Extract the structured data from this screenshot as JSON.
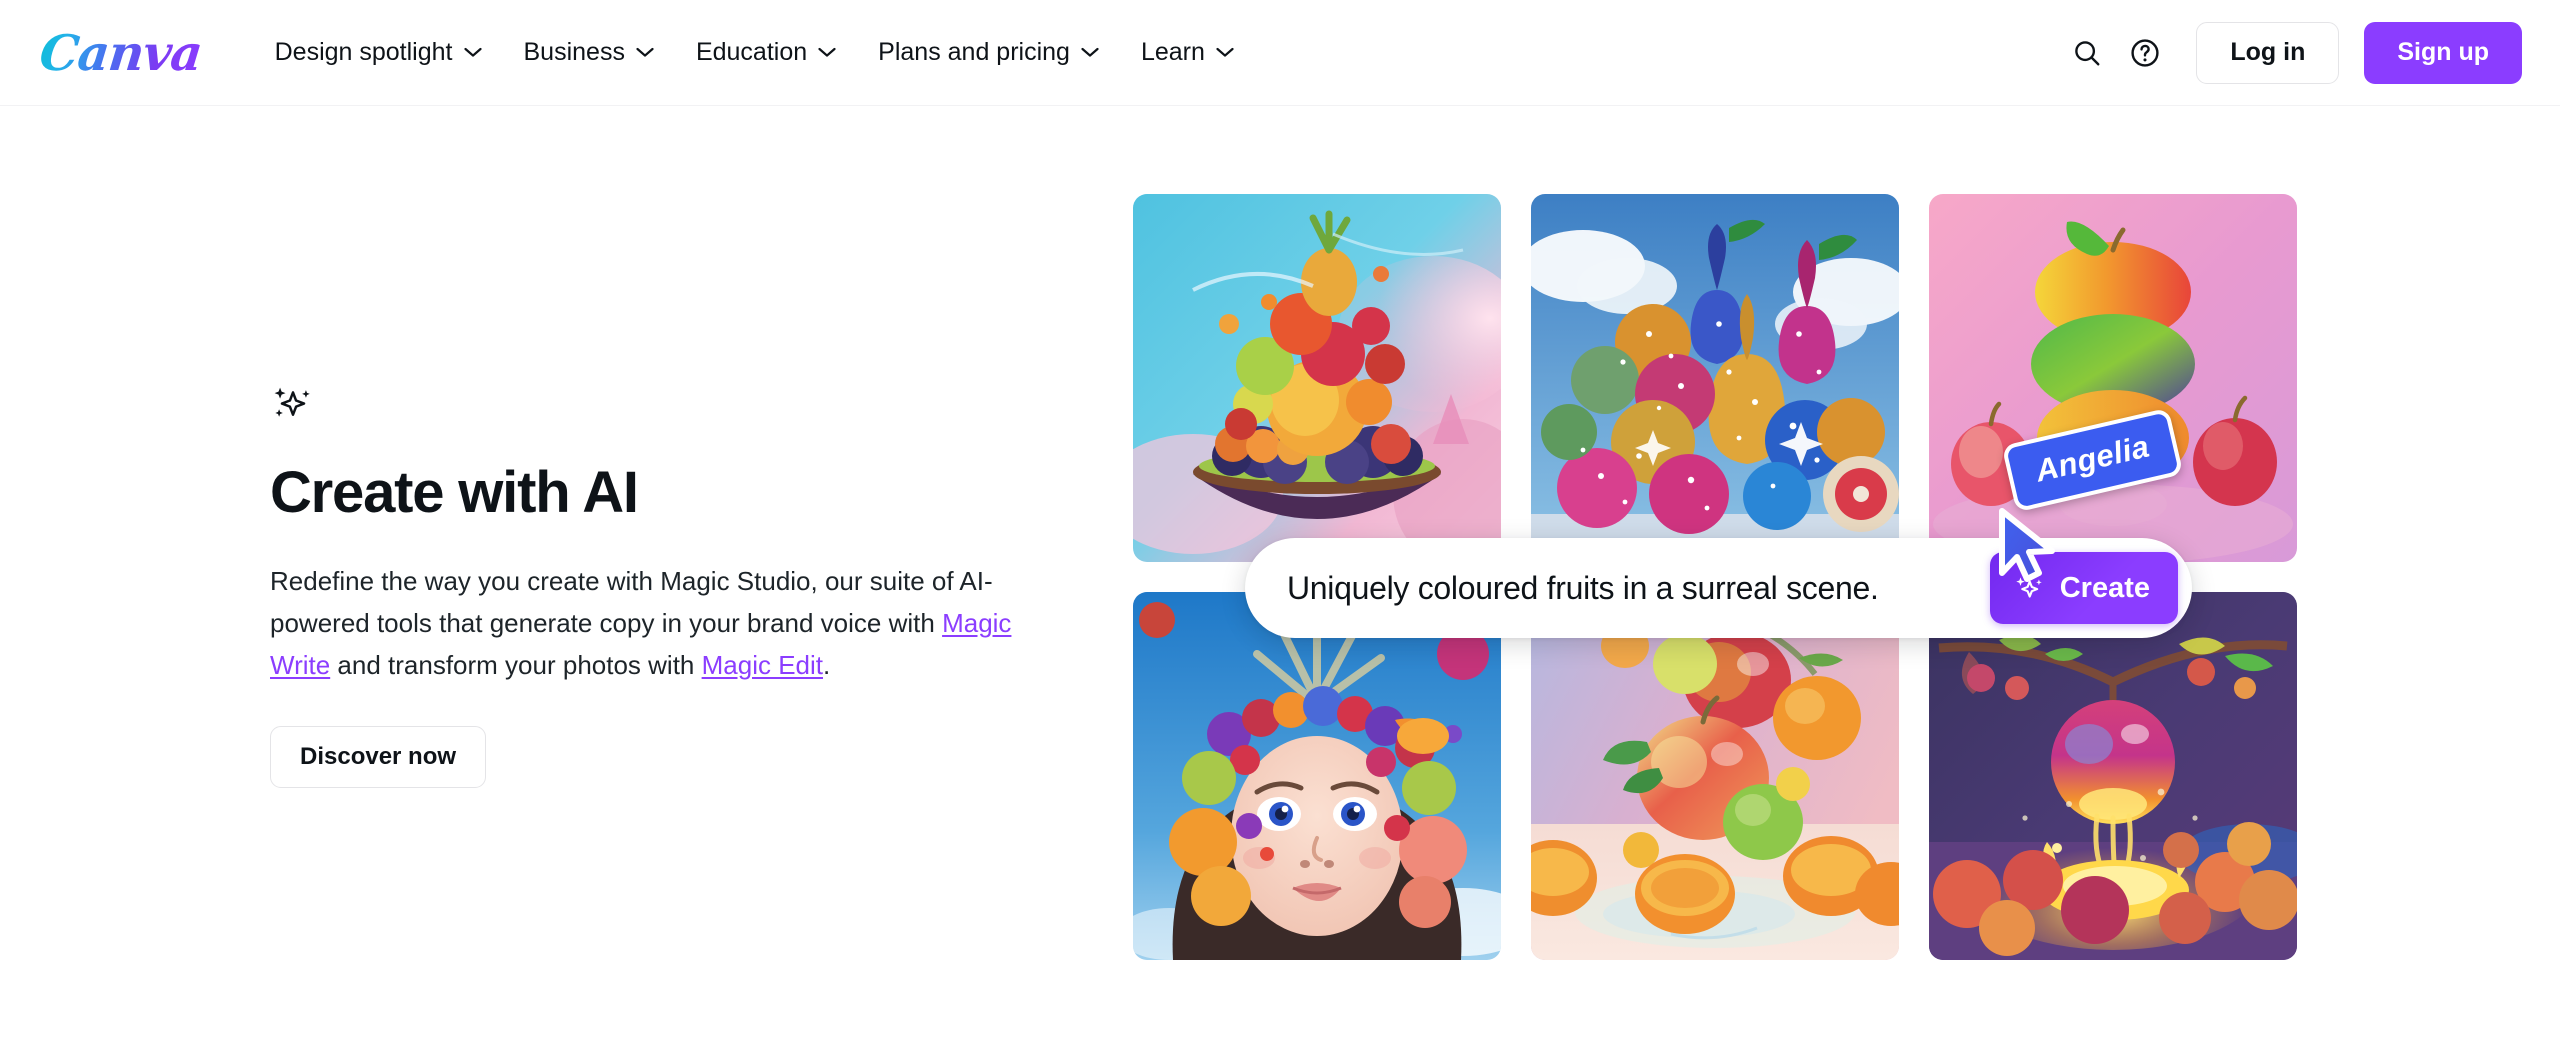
{
  "nav": {
    "logo_text": "Canva",
    "items": [
      {
        "label": "Design spotlight",
        "icon": "chevron-down-icon"
      },
      {
        "label": "Business",
        "icon": "chevron-down-icon"
      },
      {
        "label": "Education",
        "icon": "chevron-down-icon"
      },
      {
        "label": "Plans and pricing",
        "icon": "chevron-down-icon"
      },
      {
        "label": "Learn",
        "icon": "chevron-down-icon"
      }
    ],
    "search_icon": "search-icon",
    "help_icon": "help-circle-icon",
    "login_label": "Log in",
    "signup_label": "Sign up",
    "signup_color": "#8B3DFF"
  },
  "hero": {
    "icon": "sparkle-icon",
    "title": "Create with AI",
    "body_part1": "Redefine the way you create with Magic Studio, our suite of AI-powered tools that generate copy in your brand voice with ",
    "link1": "Magic Write",
    "body_part2": " and transform your photos with ",
    "link2": "Magic Edit",
    "body_part3": ".",
    "link_color": "#8B3DFF",
    "cta_label": "Discover now"
  },
  "prompt": {
    "value": "Uniquely coloured fruits in a surreal scene.",
    "create_label": "Create",
    "create_icon": "sparkle-icon",
    "create_color": "#8B3DFF",
    "cursor_icon": "mouse-pointer-icon",
    "cursor_color": "#3B5CF0"
  },
  "gallery": {
    "tiles": [
      {
        "alt": "Fruit pyramid on a floating bowl above pastel mountains",
        "position": "row1-col1"
      },
      {
        "alt": "Glittery iridescent apples and pears under a blue cloudy sky",
        "position": "row1-col2"
      },
      {
        "alt": "Rainbow gradient stacked apples on a pink background",
        "position": "row1-col3"
      },
      {
        "alt": "Portrait of a girl wearing a fruit headdress against a blue sky",
        "position": "row2-col1"
      },
      {
        "alt": "Pastel floating apples and orange halves on a reflective surface",
        "position": "row2-col2"
      },
      {
        "alt": "Glowing apple dripping golden juice in a dark purple scene",
        "position": "row2-col3"
      }
    ],
    "nametag": {
      "label": "Angelia",
      "color": "#3B5CF0"
    }
  }
}
